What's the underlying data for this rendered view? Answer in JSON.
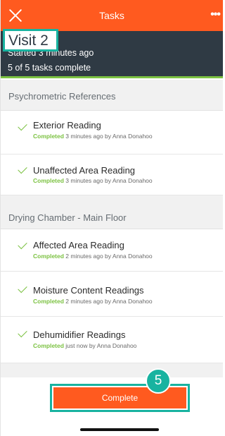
{
  "topbar": {
    "title": "Tasks",
    "close_icon": "close-icon",
    "more_icon": "more-icon",
    "more_glyph": "•••"
  },
  "header": {
    "visit": "Visit 2",
    "started": "Started 3 minutes ago",
    "progress": "5 of 5 tasks complete"
  },
  "sections": [
    {
      "title": "Psychrometric References",
      "tasks": [
        {
          "name": "Exterior Reading",
          "status": "Completed",
          "meta": " 3 minutes ago by Anna Donahoo"
        },
        {
          "name": "Unaffected Area Reading",
          "status": "Completed",
          "meta": " 3 minutes ago by Anna Donahoo"
        }
      ]
    },
    {
      "title": "Drying Chamber - Main Floor",
      "tasks": [
        {
          "name": "Affected Area Reading",
          "status": "Completed",
          "meta": " 2 minutes ago by Anna Donahoo"
        },
        {
          "name": "Moisture Content Readings",
          "status": "Completed",
          "meta": " 2 minutes ago by Anna Donahoo"
        },
        {
          "name": "Dehumidifier Readings",
          "status": "Completed",
          "meta": " just now by Anna Donahoo"
        }
      ]
    }
  ],
  "footer": {
    "complete_label": "Complete",
    "badge": "5"
  },
  "colors": {
    "accent": "#ff5a1f",
    "header": "#2f3a44",
    "success": "#7cc242",
    "highlight": "#18b3a0"
  }
}
